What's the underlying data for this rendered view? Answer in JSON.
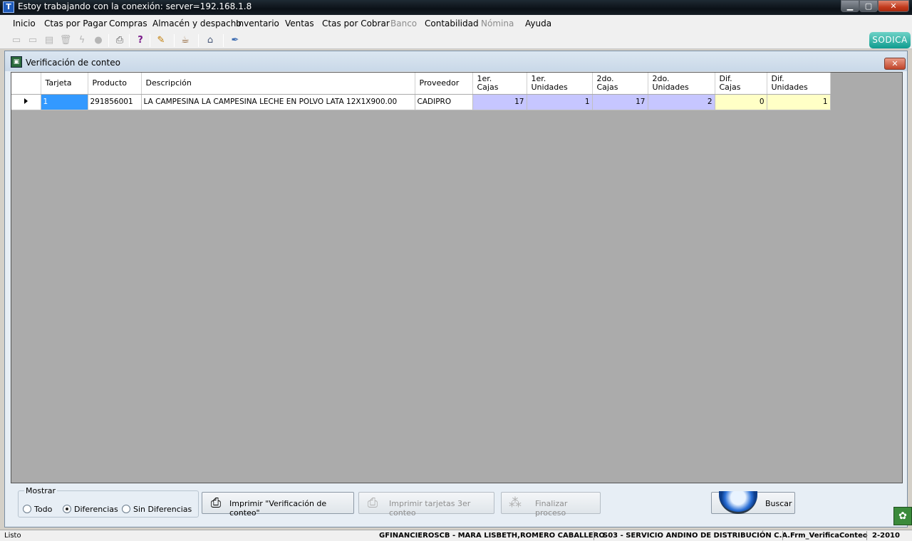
{
  "window": {
    "title": "Estoy trabajando con la conexión: server=192.168.1.8",
    "app_icon": "T",
    "min_glyph": "▁",
    "max_glyph": "▢",
    "close_glyph": "✕"
  },
  "menu": {
    "items": [
      {
        "label": "Inicio",
        "enabled": true
      },
      {
        "label": "Ctas por Pagar",
        "enabled": true
      },
      {
        "label": "Compras",
        "enabled": true
      },
      {
        "label": "Almacén y despacho",
        "enabled": true
      },
      {
        "label": "Inventario",
        "enabled": true
      },
      {
        "label": "Ventas",
        "enabled": true
      },
      {
        "label": "Ctas por Cobrar",
        "enabled": true
      },
      {
        "label": "Banco",
        "enabled": false
      },
      {
        "label": "Contabilidad",
        "enabled": true
      },
      {
        "label": "Nómina",
        "enabled": false
      },
      {
        "label": "Ayuda",
        "enabled": true
      }
    ]
  },
  "toolbar": {
    "icons": [
      {
        "name": "new-document-icon",
        "glyph": "▭",
        "enabled": false
      },
      {
        "name": "edit-document-icon",
        "glyph": "▭",
        "enabled": false
      },
      {
        "name": "save-icon",
        "glyph": "▤",
        "enabled": false
      },
      {
        "name": "delete-icon",
        "glyph": "🗑",
        "enabled": false
      },
      {
        "name": "lightning-icon",
        "glyph": "ϟ",
        "enabled": false
      },
      {
        "name": "record-icon",
        "glyph": "●",
        "enabled": false
      },
      {
        "name": "print-icon",
        "glyph": "⎙",
        "enabled": true
      },
      {
        "name": "help-icon",
        "glyph": "?",
        "enabled": true
      },
      {
        "name": "clean-icon",
        "glyph": "✎",
        "enabled": true
      },
      {
        "name": "coffee-icon",
        "glyph": "☕",
        "enabled": true
      },
      {
        "name": "bank-icon",
        "glyph": "⌂",
        "enabled": true
      },
      {
        "name": "tools-icon",
        "glyph": "✒",
        "enabled": true
      }
    ],
    "brand_badge": "SODICA"
  },
  "form": {
    "title": "Verificación de conteo",
    "close_glyph": "✕"
  },
  "grid": {
    "columns": [
      {
        "key": "tarjeta",
        "line1": "Tarjeta",
        "line2": ""
      },
      {
        "key": "producto",
        "line1": "Producto",
        "line2": ""
      },
      {
        "key": "descripcion",
        "line1": "Descripción",
        "line2": ""
      },
      {
        "key": "proveedor",
        "line1": "Proveedor",
        "line2": ""
      },
      {
        "key": "c1_cajas",
        "line1": "1er.",
        "line2": "Cajas"
      },
      {
        "key": "c1_unidades",
        "line1": "1er.",
        "line2": "Unidades"
      },
      {
        "key": "c2_cajas",
        "line1": "2do.",
        "line2": "Cajas"
      },
      {
        "key": "c2_unidades",
        "line1": "2do.",
        "line2": "Unidades"
      },
      {
        "key": "dif_cajas",
        "line1": "Dif.",
        "line2": "Cajas"
      },
      {
        "key": "dif_unidades",
        "line1": "Dif.",
        "line2": "Unidades"
      }
    ],
    "rows": [
      {
        "tarjeta": "1",
        "producto": "291856001",
        "descripcion": "LA CAMPESINA LA CAMPESINA LECHE EN POLVO LATA 12X1X900.00",
        "proveedor": "CADIPRO",
        "c1_cajas": "17",
        "c1_unidades": "1",
        "c2_cajas": "17",
        "c2_unidades": "2",
        "dif_cajas": "0",
        "dif_unidades": "1"
      }
    ],
    "colors": {
      "count_cells": "#c6c6ff",
      "diff_cells": "#ffffc6",
      "selected_cell": "#3399ff",
      "empty_area": "#ababab"
    }
  },
  "filters": {
    "legend": "Mostrar",
    "options": [
      {
        "label": "Todo",
        "selected": false
      },
      {
        "label": "Diferencias",
        "selected": true
      },
      {
        "label": "Sin Diferencias",
        "selected": false
      }
    ]
  },
  "actions": {
    "print_verification": "Imprimir \"Verificación de conteo\"",
    "print_cards": "Imprimir tarjetas 3er conteo",
    "finish_process": "Finalizar proceso",
    "search": "Buscar"
  },
  "status": {
    "state": "Listo",
    "user": "GFINANCIEROSCB - MARA LISBETH,ROMERO CABALLERO",
    "company": "S03 - SERVICIO ANDINO DE DISTRIBUCIÓN C.A.",
    "form_name": "Frm_VerificaConteo",
    "period": "2-2010"
  }
}
